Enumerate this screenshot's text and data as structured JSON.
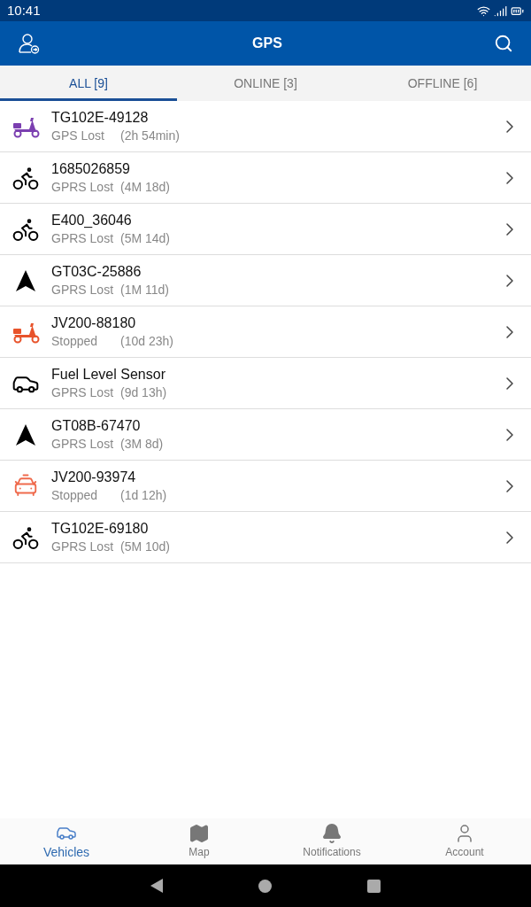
{
  "status_bar": {
    "time": "10:41"
  },
  "header": {
    "title": "GPS"
  },
  "tabs": [
    {
      "label": "ALL [9]",
      "selected": true
    },
    {
      "label": "ONLINE [3]",
      "selected": false
    },
    {
      "label": "OFFLINE [6]",
      "selected": false
    }
  ],
  "vehicles": [
    {
      "kind": "scooter",
      "color": "#7b3fb0",
      "name": "TG102E-49128",
      "status": "GPS Lost",
      "duration": "(2h 54min)"
    },
    {
      "kind": "bike",
      "color": "#000000",
      "name": "1685026859",
      "status": "GPRS Lost",
      "duration": "(4M 18d)"
    },
    {
      "kind": "bike",
      "color": "#000000",
      "name": "E400_36046",
      "status": "GPRS Lost",
      "duration": "(5M 14d)"
    },
    {
      "kind": "arrow",
      "color": "#000000",
      "name": "GT03C-25886",
      "status": "GPRS Lost",
      "duration": "(1M 11d)"
    },
    {
      "kind": "scooter",
      "color": "#e8532b",
      "name": "JV200-88180",
      "status": "Stopped",
      "duration": "(10d 23h)"
    },
    {
      "kind": "car",
      "color": "#000000",
      "name": "Fuel Level Sensor",
      "status": "GPRS Lost",
      "duration": "(9d 13h)"
    },
    {
      "kind": "arrow",
      "color": "#000000",
      "name": "GT08B-67470",
      "status": "GPRS Lost",
      "duration": "(3M 8d)"
    },
    {
      "kind": "taxi",
      "color": "#ef6a4c",
      "name": "JV200-93974",
      "status": "Stopped",
      "duration": "(1d 12h)"
    },
    {
      "kind": "bike",
      "color": "#000000",
      "name": "TG102E-69180",
      "status": "GPRS Lost",
      "duration": "(5M 10d)"
    }
  ],
  "bottom_nav": [
    {
      "kind": "car",
      "label": "Vehicles",
      "selected": true
    },
    {
      "kind": "map",
      "label": "Map",
      "selected": false
    },
    {
      "kind": "bell",
      "label": "Notifications",
      "selected": false
    },
    {
      "kind": "user",
      "label": "Account",
      "selected": false
    }
  ]
}
